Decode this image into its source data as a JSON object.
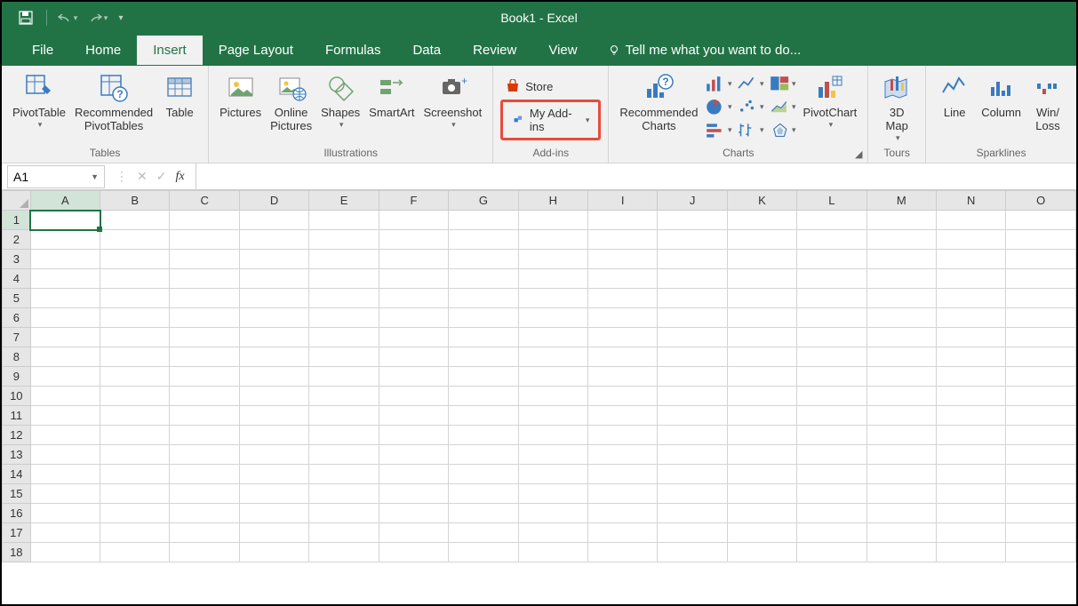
{
  "title": "Book1 - Excel",
  "tabs": [
    "File",
    "Home",
    "Insert",
    "Page Layout",
    "Formulas",
    "Data",
    "Review",
    "View"
  ],
  "active_tab": "Insert",
  "tell_me": "Tell me what you want to do...",
  "ribbon": {
    "tables": {
      "label": "Tables",
      "pivot": "PivotTable",
      "rec_pivot": "Recommended\nPivotTables",
      "table": "Table"
    },
    "illustrations": {
      "label": "Illustrations",
      "pictures": "Pictures",
      "online_pictures": "Online\nPictures",
      "shapes": "Shapes",
      "smartart": "SmartArt",
      "screenshot": "Screenshot"
    },
    "addins": {
      "label": "Add-ins",
      "store": "Store",
      "my_addins": "My Add-ins"
    },
    "charts": {
      "label": "Charts",
      "recommended": "Recommended\nCharts",
      "pivotchart": "PivotChart"
    },
    "tours": {
      "label": "Tours",
      "map": "3D\nMap"
    },
    "sparklines": {
      "label": "Sparklines",
      "line": "Line",
      "column": "Column",
      "winloss": "Win/\nLoss"
    }
  },
  "name_box": "A1",
  "fx": "fx",
  "columns": [
    "A",
    "B",
    "C",
    "D",
    "E",
    "F",
    "G",
    "H",
    "I",
    "J",
    "K",
    "L",
    "M",
    "N",
    "O"
  ],
  "rows": [
    1,
    2,
    3,
    4,
    5,
    6,
    7,
    8,
    9,
    10,
    11,
    12,
    13,
    14,
    15,
    16,
    17,
    18
  ],
  "selected_cell": "A1"
}
